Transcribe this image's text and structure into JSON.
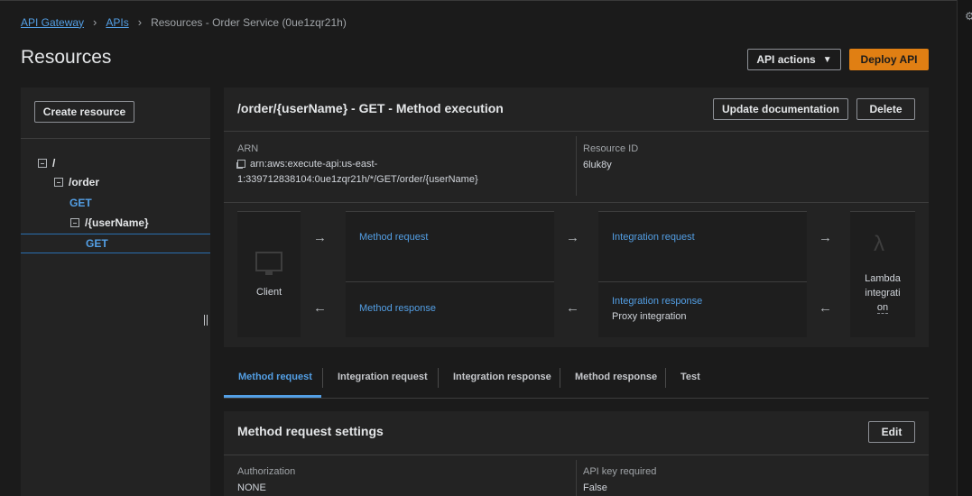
{
  "breadcrumb": {
    "home": "API Gateway",
    "apis": "APIs",
    "current": "Resources - Order Service (0ue1zqr21h)"
  },
  "page": {
    "title": "Resources",
    "api_actions_label": "API actions",
    "deploy_label": "Deploy API"
  },
  "sidebar": {
    "create_resource_label": "Create resource",
    "tree": {
      "root": "/",
      "order": "/order",
      "order_get": "GET",
      "username": "/{userName}",
      "username_get": "GET"
    }
  },
  "execution": {
    "title": "/order/{userName} - GET - Method execution",
    "update_doc_label": "Update documentation",
    "delete_label": "Delete",
    "arn_label": "ARN",
    "arn_line1": "arn:aws:execute-api:us-east-",
    "arn_line2": "1:339712838104:0ue1zqr21h/*/GET/order/{userName}",
    "resource_id_label": "Resource ID",
    "resource_id": "6luk8y",
    "client_label": "Client",
    "method_request": "Method request",
    "integration_request": "Integration request",
    "method_response": "Method response",
    "integration_response": "Integration response",
    "proxy_integration": "Proxy integration",
    "lambda_line1": "Lambda",
    "lambda_line2": "integrati",
    "lambda_line3": "on"
  },
  "tabs": [
    "Method request",
    "Integration request",
    "Integration response",
    "Method response",
    "Test"
  ],
  "settings": {
    "title": "Method request settings",
    "edit_label": "Edit",
    "authorization_label": "Authorization",
    "authorization_value": "NONE",
    "api_key_label": "API key required",
    "api_key_value": "False"
  },
  "colors": {
    "accent": "#539fe5",
    "primary_button": "#e07f13",
    "background": "#1b1b1b",
    "panel": "#232323"
  }
}
